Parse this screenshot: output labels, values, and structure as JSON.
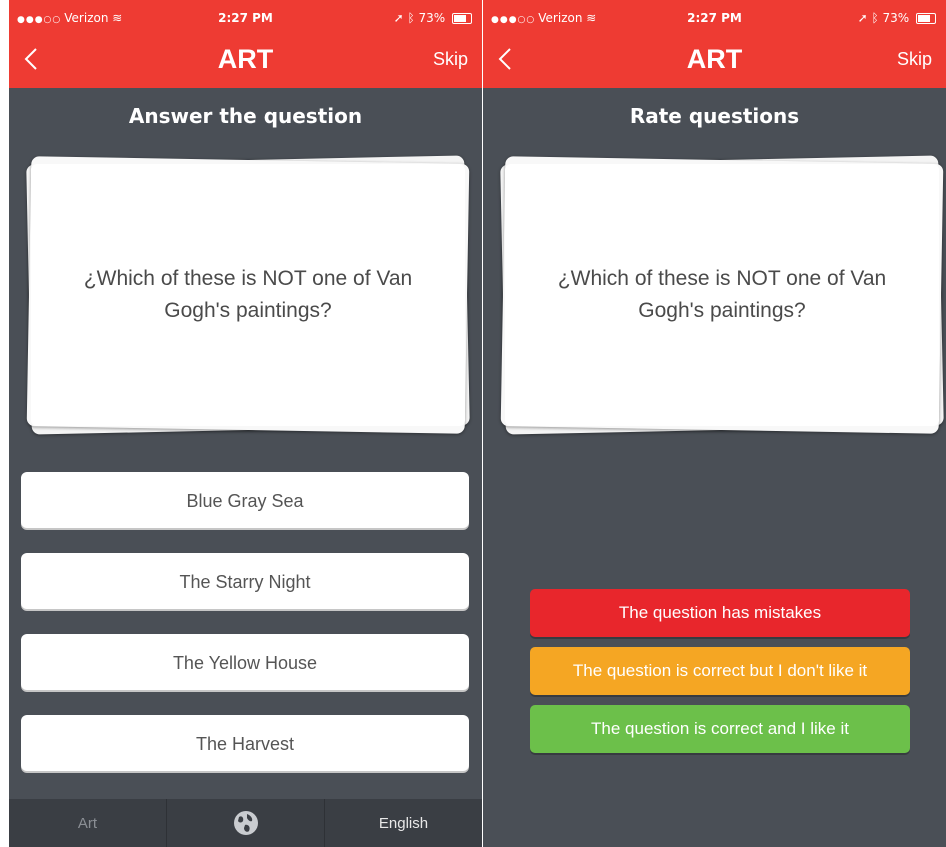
{
  "left": {
    "status": {
      "carrier": "Verizon",
      "signal": "●●●○○",
      "time": "2:27 PM",
      "battery": "73%"
    },
    "nav": {
      "title": "ART",
      "skip": "Skip"
    },
    "prompt": "Answer the question",
    "question": "¿Which of these is NOT one of Van Gogh's paintings?",
    "answers": [
      "Blue Gray Sea",
      "The Starry Night",
      "The Yellow House",
      "The Harvest"
    ],
    "tabs": {
      "category": "Art",
      "language": "English"
    }
  },
  "right": {
    "status": {
      "carrier": "Verizon",
      "signal": "●●●○○",
      "time": "2:27 PM",
      "battery": "73%"
    },
    "nav": {
      "title": "ART",
      "skip": "Skip"
    },
    "prompt": "Rate questions",
    "question": "¿Which of these is NOT one of Van Gogh's paintings?",
    "ratings": [
      {
        "label": "The question has mistakes",
        "color": "#e8262c"
      },
      {
        "label": "The question is correct but I don't like it",
        "color": "#f5a623"
      },
      {
        "label": "The question is correct and I like it",
        "color": "#6cc04a"
      }
    ]
  },
  "colors": {
    "accent": "#ee3b33",
    "background": "#4a4f56"
  },
  "icons": {
    "back": "chevron-left-icon",
    "globe": "globe-icon",
    "location": "location-arrow-icon",
    "bluetooth": "bluetooth-icon",
    "wifi": "wifi-icon"
  }
}
